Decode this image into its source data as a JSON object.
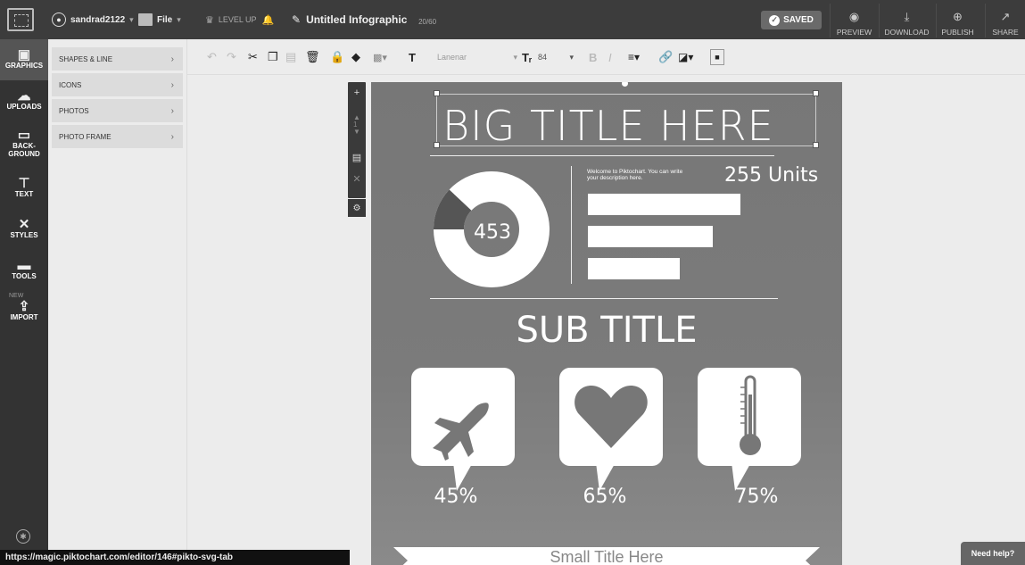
{
  "topbar": {
    "username": "sandrad2122",
    "file_label": "File",
    "level_up": "LEVEL UP",
    "doc_title": "Untitled Infographic",
    "char_count": "20/60",
    "saved_label": "SAVED",
    "actions": [
      "PREVIEW",
      "DOWNLOAD",
      "PUBLISH",
      "SHARE"
    ]
  },
  "rail": {
    "items": [
      {
        "label": "GRAPHICS",
        "icon": "image-icon"
      },
      {
        "label": "UPLOADS",
        "icon": "cloud-upload-icon"
      },
      {
        "label": "BACK-\nGROUND",
        "icon": "monitor-icon"
      },
      {
        "label": "TEXT",
        "icon": "text-icon"
      },
      {
        "label": "STYLES",
        "icon": "styles-icon"
      },
      {
        "label": "TOOLS",
        "icon": "tools-icon"
      },
      {
        "label": "IMPORT",
        "icon": "import-icon"
      }
    ],
    "new_badge": "NEW"
  },
  "submenu": {
    "items": [
      "SHAPES & LINE",
      "ICONS",
      "PHOTOS",
      "PHOTO FRAME"
    ]
  },
  "toolbar": {
    "font": "Lanenar",
    "size": "84"
  },
  "canvas": {
    "big_title": "BIG TITLE HERE",
    "description": "Welcome to Piktochart. You can write your description here.",
    "units": "255 Units",
    "donut_value": "453",
    "donut_fraction": 0.12,
    "bars": [
      1.0,
      0.82,
      0.6
    ],
    "sub_title": "SUB TITLE",
    "percents": [
      "45%",
      "65%",
      "75%"
    ],
    "small_title": "Small Title Here"
  },
  "statusbar": {
    "url": "https://magic.piktochart.com/editor/146#pikto-svg-tab"
  },
  "help": {
    "label": "Need help?"
  },
  "colors": {
    "topbar": "#3c3c3c",
    "rail": "#333333",
    "canvas": "#787878"
  }
}
